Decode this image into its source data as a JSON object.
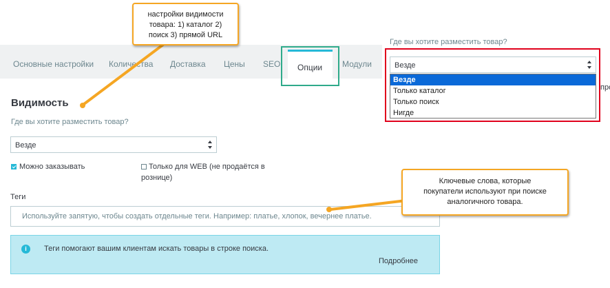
{
  "tabs": [
    {
      "label": "Основные настройки"
    },
    {
      "label": "Количества"
    },
    {
      "label": "Доставка"
    },
    {
      "label": "Цены"
    },
    {
      "label": "SEO"
    },
    {
      "label": "Опции"
    },
    {
      "label": "Модули"
    }
  ],
  "active_tab": "Опции",
  "visibility": {
    "title": "Видимость",
    "question": "Где вы хотите разместить товар?",
    "selected": "Везде",
    "options": [
      "Везде",
      "Только каталог",
      "Только поиск",
      "Нигде"
    ]
  },
  "checkboxes": {
    "orderable": {
      "label": "Можно заказывать",
      "checked": true
    },
    "web_only": {
      "label_line1": "Только для WEB (не продаётся в",
      "label_line2": "рознице)",
      "checked": false
    }
  },
  "tags": {
    "label": "Теги",
    "placeholder": "Используйте запятую, чтобы создать отдельные теги. Например: платье, хлопок, вечернее платье."
  },
  "info": {
    "icon": "info-icon",
    "text": "Теги помогают вашим клиентам искать товары в строке поиска.",
    "more": "Подробнее"
  },
  "callouts": {
    "visibility_note": [
      "настройки видимости",
      "товара: 1) каталог 2)",
      "поиск 3) прямой URL"
    ],
    "tags_note": [
      "Ключевые слова, которые",
      "покупатели используют при поиске",
      "аналогичного товара."
    ]
  },
  "dropdown_demo": {
    "question": "Где вы хотите разместить товар?",
    "selected": "Везде",
    "options": [
      "Везде",
      "Только каталог",
      "Только поиск",
      "Нигде"
    ],
    "clipped_text": "про"
  },
  "colors": {
    "accent": "#25b9d7",
    "callout_border": "#f5a623",
    "highlight_red": "#e0001b",
    "highlight_teal": "#2eaa8a",
    "selected_option": "#0a69d8"
  }
}
